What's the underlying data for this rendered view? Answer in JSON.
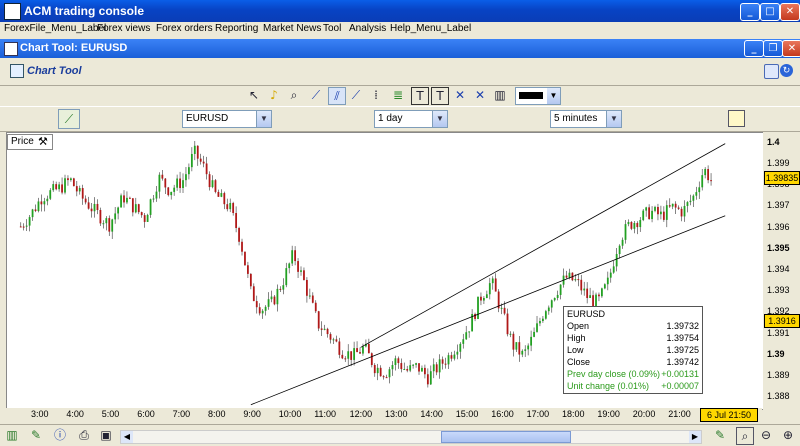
{
  "window": {
    "title": "ACM trading console"
  },
  "menu": [
    "ForexFile_Menu_Label",
    "Forex views",
    "Forex orders",
    "Reporting",
    "Market News",
    "Tool",
    "Analysis",
    "Help_Menu_Label"
  ],
  "child": {
    "title": "Chart Tool: EURUSD"
  },
  "panel": {
    "title": "Chart Tool"
  },
  "toolbar_icons": [
    "pointer-icon",
    "alert-bell-icon",
    "zoom-icon",
    "trendline-icon",
    "channel-icon",
    "vertical-line-icon",
    "fibonacci-icon",
    "text-icon",
    "text-box-icon",
    "lines-icon",
    "crosshair-icon",
    "delete-icon",
    "tools-icon"
  ],
  "controls": {
    "symbol": "EURUSD",
    "period": "1 day",
    "interval": "5 minutes",
    "line_color": "#000000"
  },
  "price_label": "Price",
  "y_ticks": [
    {
      "label": "1.4",
      "v": 1.4,
      "bold": true
    },
    {
      "label": "1.399",
      "v": 1.399
    },
    {
      "label": "1.398",
      "v": 1.398
    },
    {
      "label": "1.397",
      "v": 1.397
    },
    {
      "label": "1.396",
      "v": 1.396
    },
    {
      "label": "1.395",
      "v": 1.395,
      "bold": true
    },
    {
      "label": "1.394",
      "v": 1.394
    },
    {
      "label": "1.393",
      "v": 1.393
    },
    {
      "label": "1.392",
      "v": 1.392
    },
    {
      "label": "1.391",
      "v": 1.391
    },
    {
      "label": "1.39",
      "v": 1.39,
      "bold": true
    },
    {
      "label": "1.389",
      "v": 1.389
    },
    {
      "label": "1.388",
      "v": 1.388
    }
  ],
  "current_price": {
    "label": "1.39835",
    "v": 1.39835
  },
  "line_price": {
    "label": "1.3916",
    "v": 1.3916
  },
  "x_ticks": [
    "3:00",
    "4:00",
    "5:00",
    "6:00",
    "7:00",
    "8:00",
    "9:00",
    "10:00",
    "11:00",
    "12:00",
    "13:00",
    "14:00",
    "15:00",
    "16:00",
    "17:00",
    "18:00",
    "19:00",
    "20:00",
    "21:00"
  ],
  "date_label": "6 Jul 21:50",
  "info": {
    "symbol": "EURUSD",
    "rows": [
      {
        "k": "Open",
        "v": "1.39732"
      },
      {
        "k": "High",
        "v": "1.39754"
      },
      {
        "k": "Low",
        "v": "1.39725"
      },
      {
        "k": "Close",
        "v": "1.39742"
      }
    ],
    "green_rows": [
      {
        "k": "Prev day close (0.09%)",
        "v": "+0.00131"
      },
      {
        "k": "Unit change (0.01%)",
        "v": "+0.00007"
      }
    ]
  },
  "chart_data": {
    "type": "candlestick",
    "ylim": [
      1.3875,
      1.4005
    ],
    "x_labels": [
      "3:00",
      "4:00",
      "5:00",
      "6:00",
      "7:00",
      "8:00",
      "9:00",
      "10:00",
      "11:00",
      "12:00",
      "13:00",
      "14:00",
      "15:00",
      "16:00",
      "17:00",
      "18:00",
      "19:00",
      "20:00",
      "21:00"
    ],
    "price_path": [
      [
        2.4,
        1.3961
      ],
      [
        2.7,
        1.3967
      ],
      [
        3.0,
        1.3975
      ],
      [
        3.5,
        1.3979
      ],
      [
        3.8,
        1.3983
      ],
      [
        4.1,
        1.3975
      ],
      [
        4.5,
        1.3968
      ],
      [
        4.9,
        1.3962
      ],
      [
        5.3,
        1.3975
      ],
      [
        5.6,
        1.397
      ],
      [
        5.9,
        1.3965
      ],
      [
        6.3,
        1.3984
      ],
      [
        6.6,
        1.3978
      ],
      [
        7.0,
        1.3983
      ],
      [
        7.3,
        1.3996
      ],
      [
        7.6,
        1.3988
      ],
      [
        7.9,
        1.3976
      ],
      [
        8.3,
        1.397
      ],
      [
        8.6,
        1.3955
      ],
      [
        8.9,
        1.393
      ],
      [
        9.2,
        1.3922
      ],
      [
        9.5,
        1.3925
      ],
      [
        9.8,
        1.3935
      ],
      [
        10.1,
        1.3948
      ],
      [
        10.4,
        1.3935
      ],
      [
        10.8,
        1.3915
      ],
      [
        11.1,
        1.391
      ],
      [
        11.5,
        1.3902
      ],
      [
        11.8,
        1.39
      ],
      [
        12.1,
        1.3904
      ],
      [
        12.4,
        1.3895
      ],
      [
        12.7,
        1.3892
      ],
      [
        13.0,
        1.3898
      ],
      [
        13.3,
        1.3893
      ],
      [
        13.6,
        1.3895
      ],
      [
        13.9,
        1.389
      ],
      [
        14.2,
        1.3895
      ],
      [
        14.5,
        1.39
      ],
      [
        14.8,
        1.3907
      ],
      [
        15.1,
        1.3915
      ],
      [
        15.4,
        1.3928
      ],
      [
        15.7,
        1.3935
      ],
      [
        16.0,
        1.392
      ],
      [
        16.3,
        1.3905
      ],
      [
        16.6,
        1.39
      ],
      [
        16.9,
        1.391
      ],
      [
        17.2,
        1.3922
      ],
      [
        17.5,
        1.393
      ],
      [
        17.8,
        1.3937
      ],
      [
        18.1,
        1.3935
      ],
      [
        18.4,
        1.3928
      ],
      [
        18.7,
        1.3925
      ],
      [
        19.0,
        1.3935
      ],
      [
        19.3,
        1.3955
      ],
      [
        19.6,
        1.3962
      ],
      [
        19.9,
        1.3965
      ],
      [
        20.2,
        1.3968
      ],
      [
        20.5,
        1.3966
      ],
      [
        20.8,
        1.397
      ],
      [
        21.1,
        1.3968
      ],
      [
        21.4,
        1.3975
      ],
      [
        21.7,
        1.3988
      ],
      [
        21.9,
        1.3983
      ]
    ],
    "channel_lines": [
      {
        "from": [
          8.9,
          1.3877
        ],
        "to": [
          22.3,
          1.3966
        ]
      },
      {
        "from": [
          12.0,
          1.3904
        ],
        "to": [
          22.3,
          1.4
        ]
      }
    ]
  }
}
